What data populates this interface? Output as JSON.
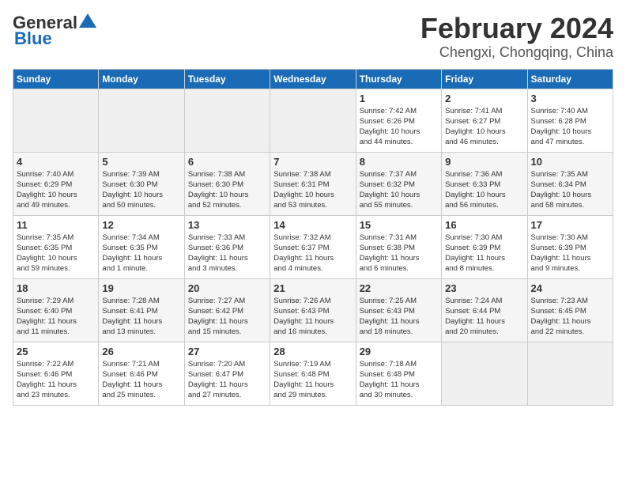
{
  "header": {
    "logo_line1": "General",
    "logo_line2": "Blue",
    "month": "February 2024",
    "location": "Chengxi, Chongqing, China"
  },
  "weekdays": [
    "Sunday",
    "Monday",
    "Tuesday",
    "Wednesday",
    "Thursday",
    "Friday",
    "Saturday"
  ],
  "weeks": [
    [
      {
        "day": "",
        "info": ""
      },
      {
        "day": "",
        "info": ""
      },
      {
        "day": "",
        "info": ""
      },
      {
        "day": "",
        "info": ""
      },
      {
        "day": "1",
        "info": "Sunrise: 7:42 AM\nSunset: 6:26 PM\nDaylight: 10 hours\nand 44 minutes."
      },
      {
        "day": "2",
        "info": "Sunrise: 7:41 AM\nSunset: 6:27 PM\nDaylight: 10 hours\nand 46 minutes."
      },
      {
        "day": "3",
        "info": "Sunrise: 7:40 AM\nSunset: 6:28 PM\nDaylight: 10 hours\nand 47 minutes."
      }
    ],
    [
      {
        "day": "4",
        "info": "Sunrise: 7:40 AM\nSunset: 6:29 PM\nDaylight: 10 hours\nand 49 minutes."
      },
      {
        "day": "5",
        "info": "Sunrise: 7:39 AM\nSunset: 6:30 PM\nDaylight: 10 hours\nand 50 minutes."
      },
      {
        "day": "6",
        "info": "Sunrise: 7:38 AM\nSunset: 6:30 PM\nDaylight: 10 hours\nand 52 minutes."
      },
      {
        "day": "7",
        "info": "Sunrise: 7:38 AM\nSunset: 6:31 PM\nDaylight: 10 hours\nand 53 minutes."
      },
      {
        "day": "8",
        "info": "Sunrise: 7:37 AM\nSunset: 6:32 PM\nDaylight: 10 hours\nand 55 minutes."
      },
      {
        "day": "9",
        "info": "Sunrise: 7:36 AM\nSunset: 6:33 PM\nDaylight: 10 hours\nand 56 minutes."
      },
      {
        "day": "10",
        "info": "Sunrise: 7:35 AM\nSunset: 6:34 PM\nDaylight: 10 hours\nand 58 minutes."
      }
    ],
    [
      {
        "day": "11",
        "info": "Sunrise: 7:35 AM\nSunset: 6:35 PM\nDaylight: 10 hours\nand 59 minutes."
      },
      {
        "day": "12",
        "info": "Sunrise: 7:34 AM\nSunset: 6:35 PM\nDaylight: 11 hours\nand 1 minute."
      },
      {
        "day": "13",
        "info": "Sunrise: 7:33 AM\nSunset: 6:36 PM\nDaylight: 11 hours\nand 3 minutes."
      },
      {
        "day": "14",
        "info": "Sunrise: 7:32 AM\nSunset: 6:37 PM\nDaylight: 11 hours\nand 4 minutes."
      },
      {
        "day": "15",
        "info": "Sunrise: 7:31 AM\nSunset: 6:38 PM\nDaylight: 11 hours\nand 6 minutes."
      },
      {
        "day": "16",
        "info": "Sunrise: 7:30 AM\nSunset: 6:39 PM\nDaylight: 11 hours\nand 8 minutes."
      },
      {
        "day": "17",
        "info": "Sunrise: 7:30 AM\nSunset: 6:39 PM\nDaylight: 11 hours\nand 9 minutes."
      }
    ],
    [
      {
        "day": "18",
        "info": "Sunrise: 7:29 AM\nSunset: 6:40 PM\nDaylight: 11 hours\nand 11 minutes."
      },
      {
        "day": "19",
        "info": "Sunrise: 7:28 AM\nSunset: 6:41 PM\nDaylight: 11 hours\nand 13 minutes."
      },
      {
        "day": "20",
        "info": "Sunrise: 7:27 AM\nSunset: 6:42 PM\nDaylight: 11 hours\nand 15 minutes."
      },
      {
        "day": "21",
        "info": "Sunrise: 7:26 AM\nSunset: 6:43 PM\nDaylight: 11 hours\nand 16 minutes."
      },
      {
        "day": "22",
        "info": "Sunrise: 7:25 AM\nSunset: 6:43 PM\nDaylight: 11 hours\nand 18 minutes."
      },
      {
        "day": "23",
        "info": "Sunrise: 7:24 AM\nSunset: 6:44 PM\nDaylight: 11 hours\nand 20 minutes."
      },
      {
        "day": "24",
        "info": "Sunrise: 7:23 AM\nSunset: 6:45 PM\nDaylight: 11 hours\nand 22 minutes."
      }
    ],
    [
      {
        "day": "25",
        "info": "Sunrise: 7:22 AM\nSunset: 6:46 PM\nDaylight: 11 hours\nand 23 minutes."
      },
      {
        "day": "26",
        "info": "Sunrise: 7:21 AM\nSunset: 6:46 PM\nDaylight: 11 hours\nand 25 minutes."
      },
      {
        "day": "27",
        "info": "Sunrise: 7:20 AM\nSunset: 6:47 PM\nDaylight: 11 hours\nand 27 minutes."
      },
      {
        "day": "28",
        "info": "Sunrise: 7:19 AM\nSunset: 6:48 PM\nDaylight: 11 hours\nand 29 minutes."
      },
      {
        "day": "29",
        "info": "Sunrise: 7:18 AM\nSunset: 6:48 PM\nDaylight: 11 hours\nand 30 minutes."
      },
      {
        "day": "",
        "info": ""
      },
      {
        "day": "",
        "info": ""
      }
    ]
  ]
}
